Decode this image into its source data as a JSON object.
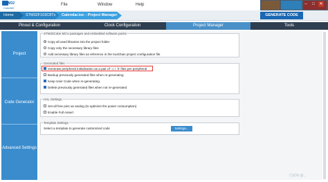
{
  "app": {
    "logo_line1": "STM32",
    "logo_line2": "CubeMX"
  },
  "menu": {
    "file": "File",
    "window": "Window",
    "help": "Help"
  },
  "window_controls": {
    "minimize": "–",
    "maximize": "□",
    "close": "✕"
  },
  "breadcrumb": {
    "home": "Home",
    "project": "STM32F103C8Tx",
    "current": "Calendar.ioc - Project Manager"
  },
  "generate_button": "GENERATE CODE",
  "tabs": {
    "pinout": "Pinout & Configuration",
    "clock": "Clock Configuration",
    "project_manager": "Project Manager",
    "tools": "Tools"
  },
  "sidebar": {
    "project": "Project",
    "code_generator": "Code Generator",
    "advanced": "Advanced Settings"
  },
  "mcu_group": {
    "title": "STM32Cube MCU packages and embedded software packs",
    "options": [
      {
        "label": "Copy all used libraries into the project folder",
        "selected": true
      },
      {
        "label": "Copy only the necessary library files",
        "selected": false
      },
      {
        "label": "Add necessary library files as reference in the toolchain project configuration file",
        "selected": false
      }
    ]
  },
  "generated_files": {
    "title": "Generated files",
    "options": [
      {
        "label": "Generate peripheral initialization as a pair of '.c / .h' files per peripheral",
        "checked": true
      },
      {
        "label": "Backup previously generated files when re-generating",
        "checked": false
      },
      {
        "label": "Keep User Code when re-generating",
        "checked": true
      },
      {
        "label": "Delete previously generated files when not re-generated",
        "checked": true
      }
    ]
  },
  "hal_settings": {
    "title": "HAL Settings",
    "options": [
      {
        "label": "Set all free pins as analog (to optimize the power consumption)",
        "checked": false
      },
      {
        "label": "Enable Full Assert",
        "checked": false
      }
    ]
  },
  "template_settings": {
    "title": "Template Settings",
    "text": "Select a template to generate customized code",
    "button": "Settings..."
  },
  "watermark": "CSDN @..."
}
